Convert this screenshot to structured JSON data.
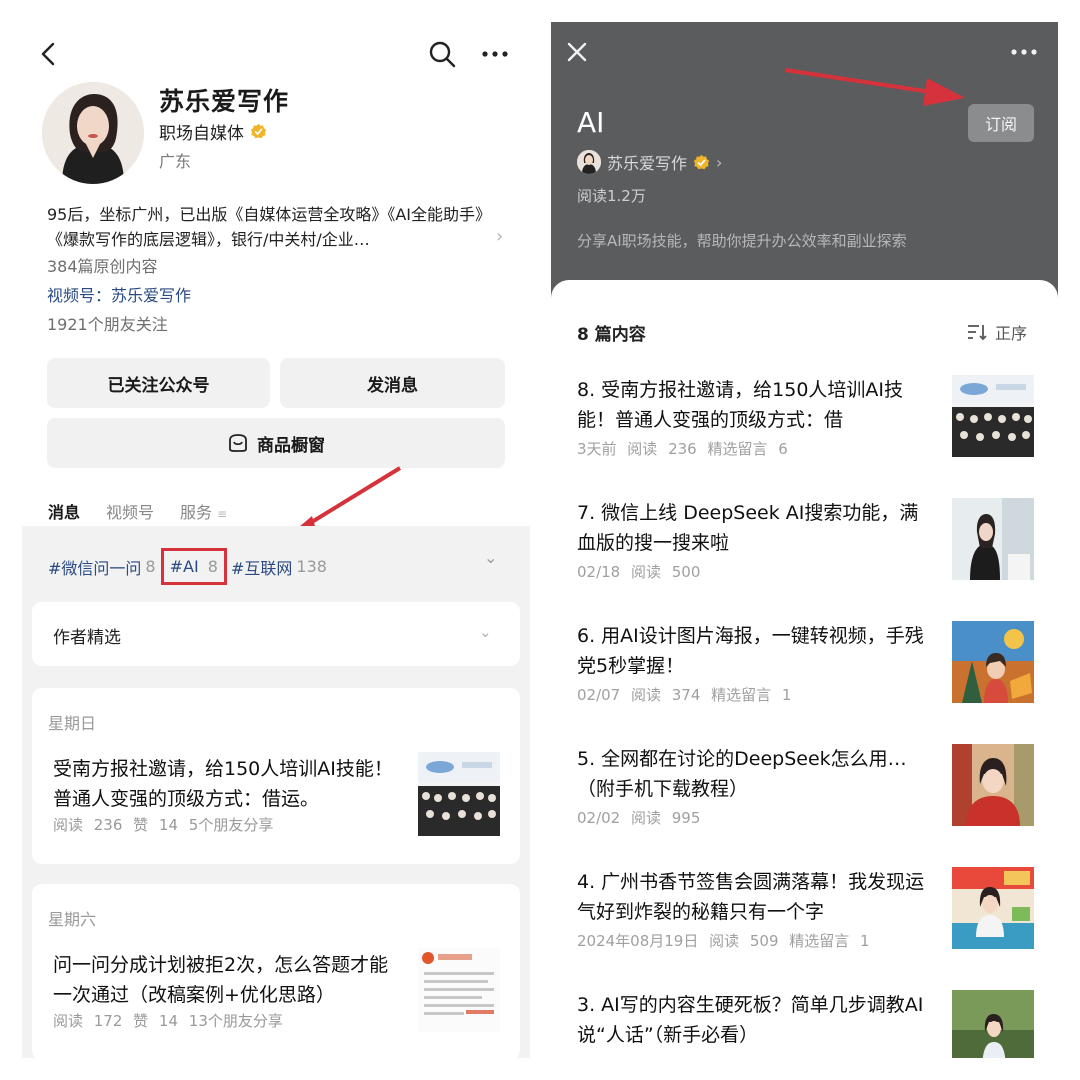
{
  "left": {
    "profile": {
      "name": "苏乐爱写作",
      "category": "职场自媒体",
      "region": "广东",
      "bio": "95后，坐标广州，已出版《自媒体运营全攻略》《AI全能助手》《爆款写作的底层逻辑》，银行/中关村/企业…",
      "original_count": "384篇原创内容",
      "video_account": "视频号：苏乐爱写作",
      "friends_following": "1921个朋友关注"
    },
    "buttons": {
      "followed": "已关注公众号",
      "message": "发消息",
      "shop": "商品橱窗"
    },
    "tabs": [
      "消息",
      "视频号",
      "服务"
    ],
    "tags": [
      {
        "label": "#微信问一问",
        "count": "8"
      },
      {
        "label": "#AI",
        "count": "8"
      },
      {
        "label": "#互联网",
        "count": "138"
      }
    ],
    "author_pick": "作者精选",
    "posts": [
      {
        "day": "星期日",
        "title": "受南方报社邀请，给150人培训AI技能！普通人变强的顶级方式：借运。",
        "meta": "阅读 236  赞 14  5个朋友分享"
      },
      {
        "day": "星期六",
        "title": "问一问分成计划被拒2次，怎么答题才能一次通过（改稿案例+优化思路）",
        "meta": "阅读 172  赞 14  13个朋友分享"
      }
    ]
  },
  "right": {
    "collection_title": "AI",
    "subscribe": "订阅",
    "author": "苏乐爱写作",
    "reads": "阅读1.2万",
    "description": "分享AI职场技能，帮助你提升办公效率和副业探索",
    "count": "8 篇内容",
    "sort": "正序",
    "articles": [
      {
        "title": "8. 受南方报社邀请，给150人培训AI技能！普通人变强的顶级方式：借",
        "meta": "3天前  阅读 236  精选留言 6"
      },
      {
        "title": "7. 微信上线 DeepSeek AI搜索功能，满血版的搜一搜来啦",
        "meta": "02/18  阅读 500"
      },
      {
        "title": "6. 用AI设计图片海报，一键转视频，手残党5秒掌握！",
        "meta": "02/07  阅读 374  精选留言 1"
      },
      {
        "title": "5. 全网都在讨论的DeepSeek怎么用…（附手机下载教程）",
        "meta": "02/02  阅读 995"
      },
      {
        "title": "4. 广州书香节签售会圆满落幕！我发现运气好到炸裂的秘籍只有一个字",
        "meta": "2024年08月19日  阅读 509  精选留言 1"
      },
      {
        "title": "3. AI写的内容生硬死板？简单几步调教AI说“人话”（新手必看）",
        "meta": ""
      }
    ]
  },
  "colors": {
    "link_blue": "#2b4a83",
    "highlight_red": "#d5323b",
    "header_gray": "#5b5c5e",
    "verified_gold": "#f0b429"
  }
}
